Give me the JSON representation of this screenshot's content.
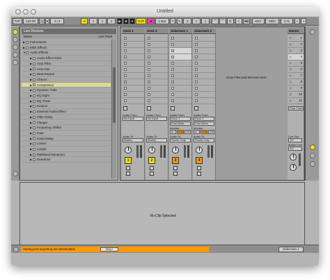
{
  "window": {
    "title": "Untitled"
  },
  "toolbar": {
    "tap": "TAP",
    "tempo": "120.00",
    "meter": "4 / 4",
    "nudge": "|||",
    "pos1": "1",
    "pos2": "1",
    "pos3": "1",
    "ovr": "OVR",
    "bar": "1 Bar",
    "loop1": "3",
    "loop2": "1",
    "loop3": "1",
    "key": "KEY",
    "midi": "MIDI",
    "cpu": "0 %"
  },
  "browser": {
    "header": "Live Devices",
    "sub_label": "Live Pack",
    "col_name": "Name",
    "items": [
      {
        "label": "Instruments",
        "level": 0,
        "arrow": "▶"
      },
      {
        "label": "MIDI Effects",
        "level": 0,
        "arrow": "▶"
      },
      {
        "label": "Audio Effects",
        "level": 0,
        "arrow": "▼"
      },
      {
        "label": "Audio Effect Rack",
        "level": 1,
        "arrow": "▶"
      },
      {
        "label": "Auto Filter",
        "level": 1,
        "arrow": "▶"
      },
      {
        "label": "Auto Pan",
        "level": 1,
        "arrow": "▶"
      },
      {
        "label": "Beat Repeat",
        "level": 1,
        "arrow": "▶"
      },
      {
        "label": "Chorus",
        "level": 1,
        "arrow": "▶"
      },
      {
        "label": "Compressor",
        "level": 1,
        "arrow": "▶",
        "selected": true
      },
      {
        "label": "Dynamic Tube",
        "level": 1,
        "arrow": "▶"
      },
      {
        "label": "EQ Eight",
        "level": 1,
        "arrow": "▶"
      },
      {
        "label": "EQ Three",
        "level": 1,
        "arrow": "▶"
      },
      {
        "label": "Erosion",
        "level": 1,
        "arrow": "▶"
      },
      {
        "label": "External Audio Effect",
        "level": 1,
        "arrow": "▶"
      },
      {
        "label": "Filter Delay",
        "level": 1,
        "arrow": "▶"
      },
      {
        "label": "Flanger",
        "level": 1,
        "arrow": "▶"
      },
      {
        "label": "Frequency Shifter",
        "level": 1,
        "arrow": "▶"
      },
      {
        "label": "Gate",
        "level": 1,
        "arrow": "▶"
      },
      {
        "label": "Grain Delay",
        "level": 1,
        "arrow": "▶"
      },
      {
        "label": "Limiter",
        "level": 1,
        "arrow": "▶"
      },
      {
        "label": "Looper",
        "level": 1,
        "arrow": "▶"
      },
      {
        "label": "Multiband Dynamics",
        "level": 1,
        "arrow": "▶"
      },
      {
        "label": "Overdrive",
        "level": 1,
        "arrow": "▶"
      }
    ]
  },
  "session": {
    "drop_text": "Drop Files and Devices Here",
    "stop_clips": "Stop Clips",
    "tracks": [
      {
        "name": "Deck 1",
        "number": "1",
        "color": "#f2e000",
        "audio_from": "No Input",
        "audio_to": "Master"
      },
      {
        "name": "Deck 2",
        "number": "2",
        "color": "#f2e000",
        "audio_from": "No Input",
        "audio_to": "Master"
      },
      {
        "name": "Sidechain 1",
        "number": "3",
        "color": "#ff9a00",
        "audio_from": "Deck 1",
        "audio_to": "Sends Only",
        "chan": "Post Mixer",
        "monitor": true
      },
      {
        "name": "Sidechain 2",
        "number": "4",
        "color": "#ff9a00",
        "audio_from": "Deck 2",
        "audio_to": "Sends Only",
        "chan": "Post Mixer",
        "monitor": true
      }
    ],
    "master": {
      "name": "Master",
      "scenes": [
        "1",
        "2",
        "3",
        "4",
        "5",
        "6",
        "7",
        "8",
        "9",
        "10",
        "11"
      ],
      "cue_out_label": "Cue Out",
      "cue_out_value": "1/2",
      "master_out_label": "Master Out",
      "master_out_value": "1/2"
    },
    "labels": {
      "audio_from": "Audio From",
      "audio_to": "Audio To",
      "monitor": "Monitor",
      "in": "In",
      "auto": "Auto",
      "off": "Off"
    }
  },
  "detail": {
    "empty_text": "No Clip Selected"
  },
  "status": {
    "message": "Saving and exporting are deactivated.",
    "why": "Why?",
    "selected_track": "Sidechain 1"
  }
}
